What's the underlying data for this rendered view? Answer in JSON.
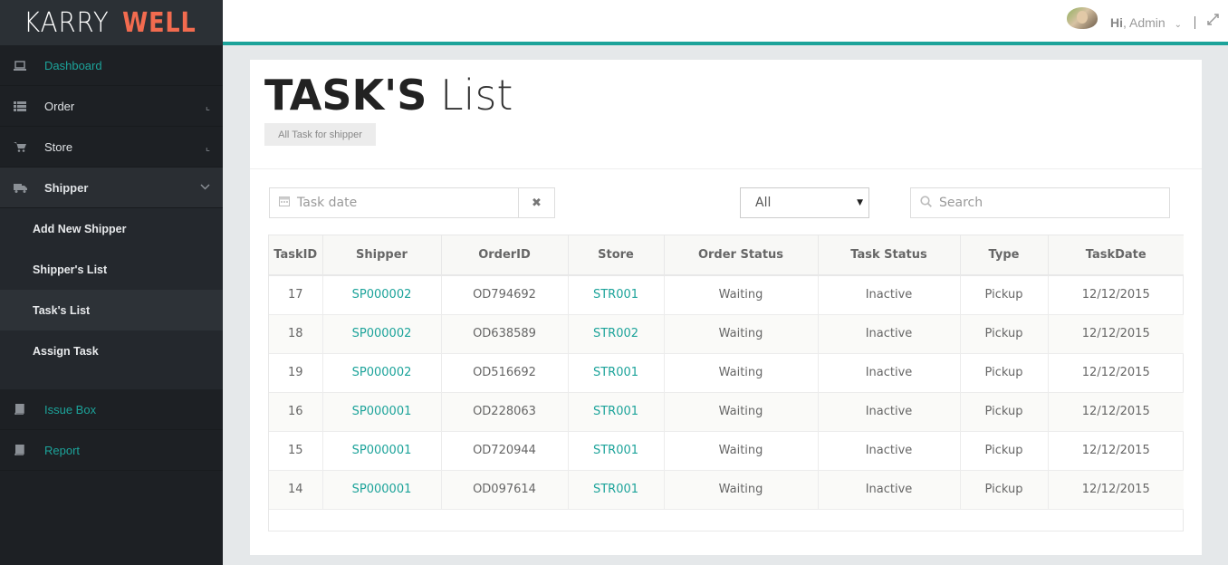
{
  "brand": {
    "part1": "KARRY",
    "part2": "WELL"
  },
  "sidebar": {
    "items": [
      {
        "label": "Dashboard",
        "icon": "laptop-icon"
      },
      {
        "label": "Order",
        "icon": "list-icon"
      },
      {
        "label": "Store",
        "icon": "cart-icon"
      },
      {
        "label": "Shipper",
        "icon": "truck-icon"
      },
      {
        "label": "Issue Box",
        "icon": "book-icon"
      },
      {
        "label": "Report",
        "icon": "book-icon"
      }
    ],
    "shipper_sub": [
      {
        "label": "Add New Shipper"
      },
      {
        "label": "Shipper's List"
      },
      {
        "label": "Task's List"
      },
      {
        "label": "Assign Task"
      }
    ]
  },
  "topbar": {
    "greeting_hi": "Hi",
    "greeting_name": ", Admin"
  },
  "page": {
    "title_bold": "TASK'S",
    "title_light": "List",
    "subtitle": "All Task for shipper"
  },
  "filters": {
    "date_placeholder": "Task date",
    "status_selected": "All",
    "search_placeholder": "Search"
  },
  "table": {
    "columns": [
      "TaskID",
      "Shipper",
      "OrderID",
      "Store",
      "Order Status",
      "Task Status",
      "Type",
      "TaskDate"
    ],
    "rows": [
      [
        "17",
        "SP000002",
        "OD794692",
        "STR001",
        "Waiting",
        "Inactive",
        "Pickup",
        "12/12/2015"
      ],
      [
        "18",
        "SP000002",
        "OD638589",
        "STR002",
        "Waiting",
        "Inactive",
        "Pickup",
        "12/12/2015"
      ],
      [
        "19",
        "SP000002",
        "OD516692",
        "STR001",
        "Waiting",
        "Inactive",
        "Pickup",
        "12/12/2015"
      ],
      [
        "16",
        "SP000001",
        "OD228063",
        "STR001",
        "Waiting",
        "Inactive",
        "Pickup",
        "12/12/2015"
      ],
      [
        "15",
        "SP000001",
        "OD720944",
        "STR001",
        "Waiting",
        "Inactive",
        "Pickup",
        "12/12/2015"
      ],
      [
        "14",
        "SP000001",
        "OD097614",
        "STR001",
        "Waiting",
        "Inactive",
        "Pickup",
        "12/12/2015"
      ]
    ]
  },
  "colors": {
    "accent": "#1ca39a",
    "brand": "#f26b4f",
    "sidebar_bg": "#1d2024"
  }
}
